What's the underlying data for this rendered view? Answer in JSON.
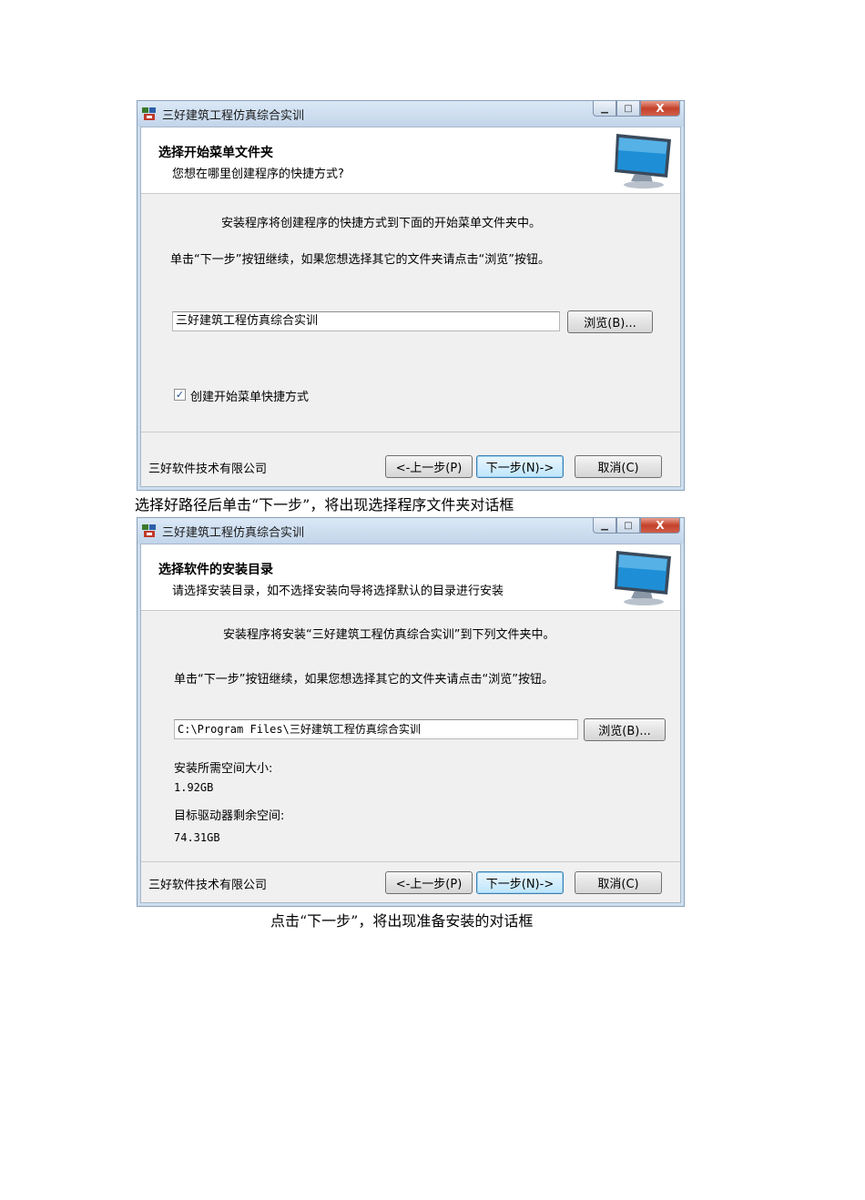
{
  "windows": [
    {
      "title": "三好建筑工程仿真综合实训",
      "header_title": "选择开始菜单文件夹",
      "header_subtitle": "您想在哪里创建程序的快捷方式?",
      "info_text": "安装程序将创建程序的快捷方式到下面的开始菜单文件夹中。",
      "instruction": "单击“下一步”按钮继续，如果您想选择其它的文件夹请点击“浏览”按钮。",
      "folder_value": "三好建筑工程仿真综合实训",
      "browse_label": "浏览(B)...",
      "checkbox_label": "创建开始菜单快捷方式",
      "checkbox_checked": true,
      "company": "三好软件技术有限公司",
      "back_label": "<-上一步(P)",
      "next_label": "下一步(N)->",
      "cancel_label": "取消(C)"
    },
    {
      "title": "三好建筑工程仿真综合实训",
      "header_title": "选择软件的安装目录",
      "header_subtitle": "请选择安装目录，如不选择安装向导将选择默认的目录进行安装",
      "info_text": "安装程序将安装“三好建筑工程仿真综合实训”到下列文件夹中。",
      "instruction": "单击“下一步”按钮继续，如果您想选择其它的文件夹请点击“浏览”按钮。",
      "folder_value": "C:\\Program Files\\三好建筑工程仿真综合实训",
      "browse_label": "浏览(B)...",
      "space_required_label": "安装所需空间大小:",
      "space_required_value": "1.92GB",
      "space_free_label": "目标驱动器剩余空间:",
      "space_free_value": "74.31GB",
      "company": "三好软件技术有限公司",
      "back_label": "<-上一步(P)",
      "next_label": "下一步(N)->",
      "cancel_label": "取消(C)"
    }
  ],
  "captions": [
    "选择好路径后单击“下一步”，将出现选择程序文件夹对话框",
    "点击“下一步”，将出现准备安装的对话框"
  ],
  "icons": {
    "app": "app-logo-icon",
    "monitor": "monitor-icon",
    "minimize": "minimize-icon",
    "maximize": "maximize-icon",
    "close": "close-icon"
  }
}
